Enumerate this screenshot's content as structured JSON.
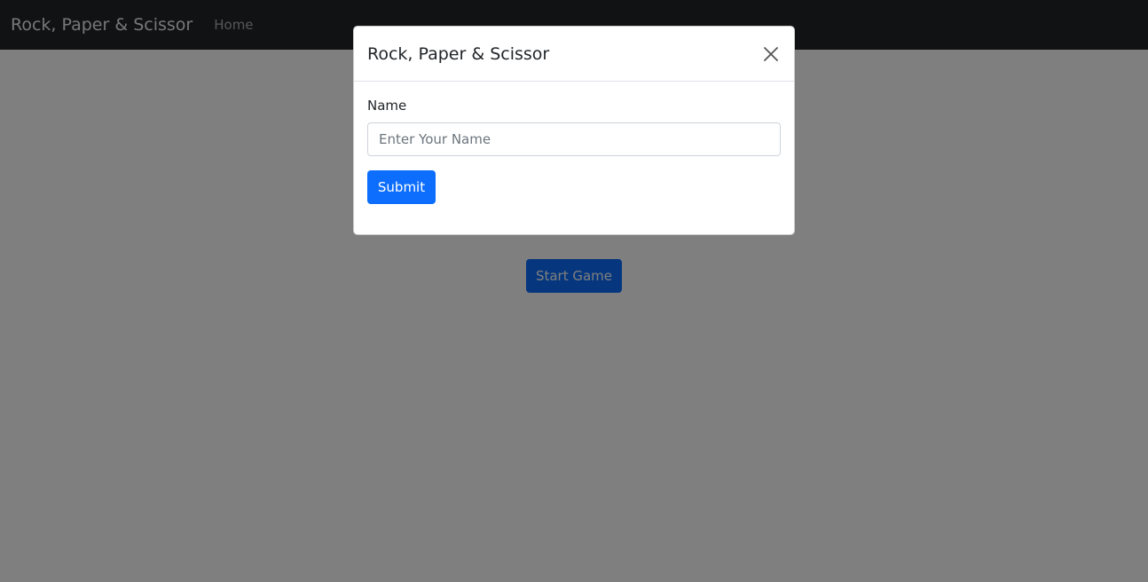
{
  "navbar": {
    "brand": "Rock, Paper & Scissor",
    "home_label": "Home"
  },
  "main": {
    "start_button_label": "Start Game"
  },
  "modal": {
    "title": "Rock, Paper & Scissor",
    "close_icon": "close-icon",
    "name_label": "Name",
    "name_input": {
      "value": "",
      "placeholder": "Enter Your Name"
    },
    "submit_label": "Submit"
  },
  "colors": {
    "navbar_bg": "#212529",
    "primary": "#0d6efd",
    "backdrop": "rgba(0,0,0,0.5)"
  }
}
